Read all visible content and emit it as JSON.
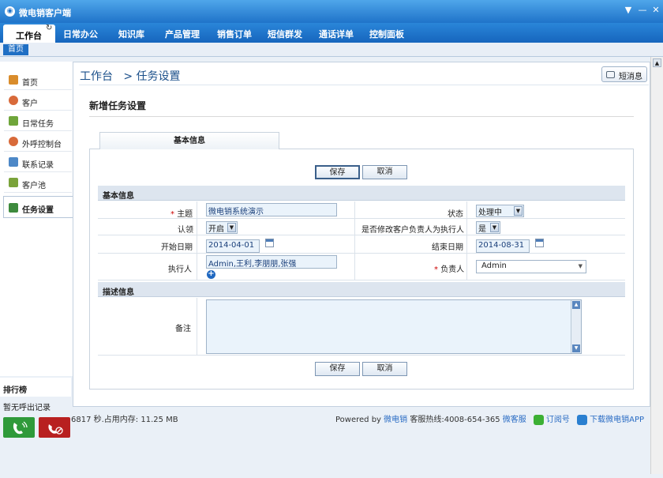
{
  "app": {
    "title": "微电销客户端",
    "window_buttons": [
      "▼",
      "—",
      "✕"
    ]
  },
  "menu": {
    "active": "工作台",
    "items": [
      "日常办公",
      "知识库",
      "产品管理",
      "销售订单",
      "短信群发",
      "通话详单",
      "控制面板"
    ]
  },
  "crumb_tab": "首页",
  "sidebar": {
    "items": [
      {
        "label": "首页",
        "icon": "home-icon",
        "color": "#d98c2b"
      },
      {
        "label": "客户",
        "icon": "user-icon",
        "color": "#d86a3a"
      },
      {
        "label": "日常任务",
        "icon": "tasks-icon",
        "color": "#6fa53a"
      },
      {
        "label": "外呼控制台",
        "icon": "agent-icon",
        "color": "#d86a3a"
      },
      {
        "label": "联系记录",
        "icon": "record-icon",
        "color": "#4d88c7"
      },
      {
        "label": "客户池",
        "icon": "pool-icon",
        "color": "#7aa33a"
      },
      {
        "label": "任务设置",
        "icon": "settings-icon",
        "color": "#3d8a3d"
      }
    ]
  },
  "rank": {
    "title": "排行榜",
    "empty": "暂无呼出记录"
  },
  "header": {
    "breadcrumb": "工作台   > 任务设置",
    "message_button": "短消息"
  },
  "form": {
    "title": "新增任务设置",
    "tab": "基本信息",
    "save": "保存",
    "cancel": "取消",
    "group_basic": "基本信息",
    "group_desc": "描述信息",
    "required_mark": "*",
    "subject_label": "主题",
    "subject_value": "微电销系统演示",
    "status_label": "状态",
    "status_value": "处理中",
    "claim_label": "认领",
    "claim_value": "开启",
    "modify_owner_label": "是否修改客户负责人为执行人",
    "modify_owner_value": "是",
    "start_label": "开始日期",
    "start_value": "2014-04-01",
    "end_label": "结束日期",
    "end_value": "2014-08-31",
    "executor_label": "执行人",
    "executor_value": "Admin,王利,李朋朋,张强",
    "owner_label": "负责人",
    "owner_value": "Admin",
    "remark_label": "备注"
  },
  "status_text": "6817 秒.占用内存: 11.25 MB",
  "footer": {
    "powered": "Powered by",
    "brand": "微电销",
    "hotline": "客服热线:4008-654-365",
    "service": "微客服",
    "subscribe": "订阅号",
    "download": "下载微电销APP"
  },
  "colors": {
    "accent": "#1f73c9",
    "call_green": "#2f9a3a",
    "call_red": "#b82020"
  }
}
